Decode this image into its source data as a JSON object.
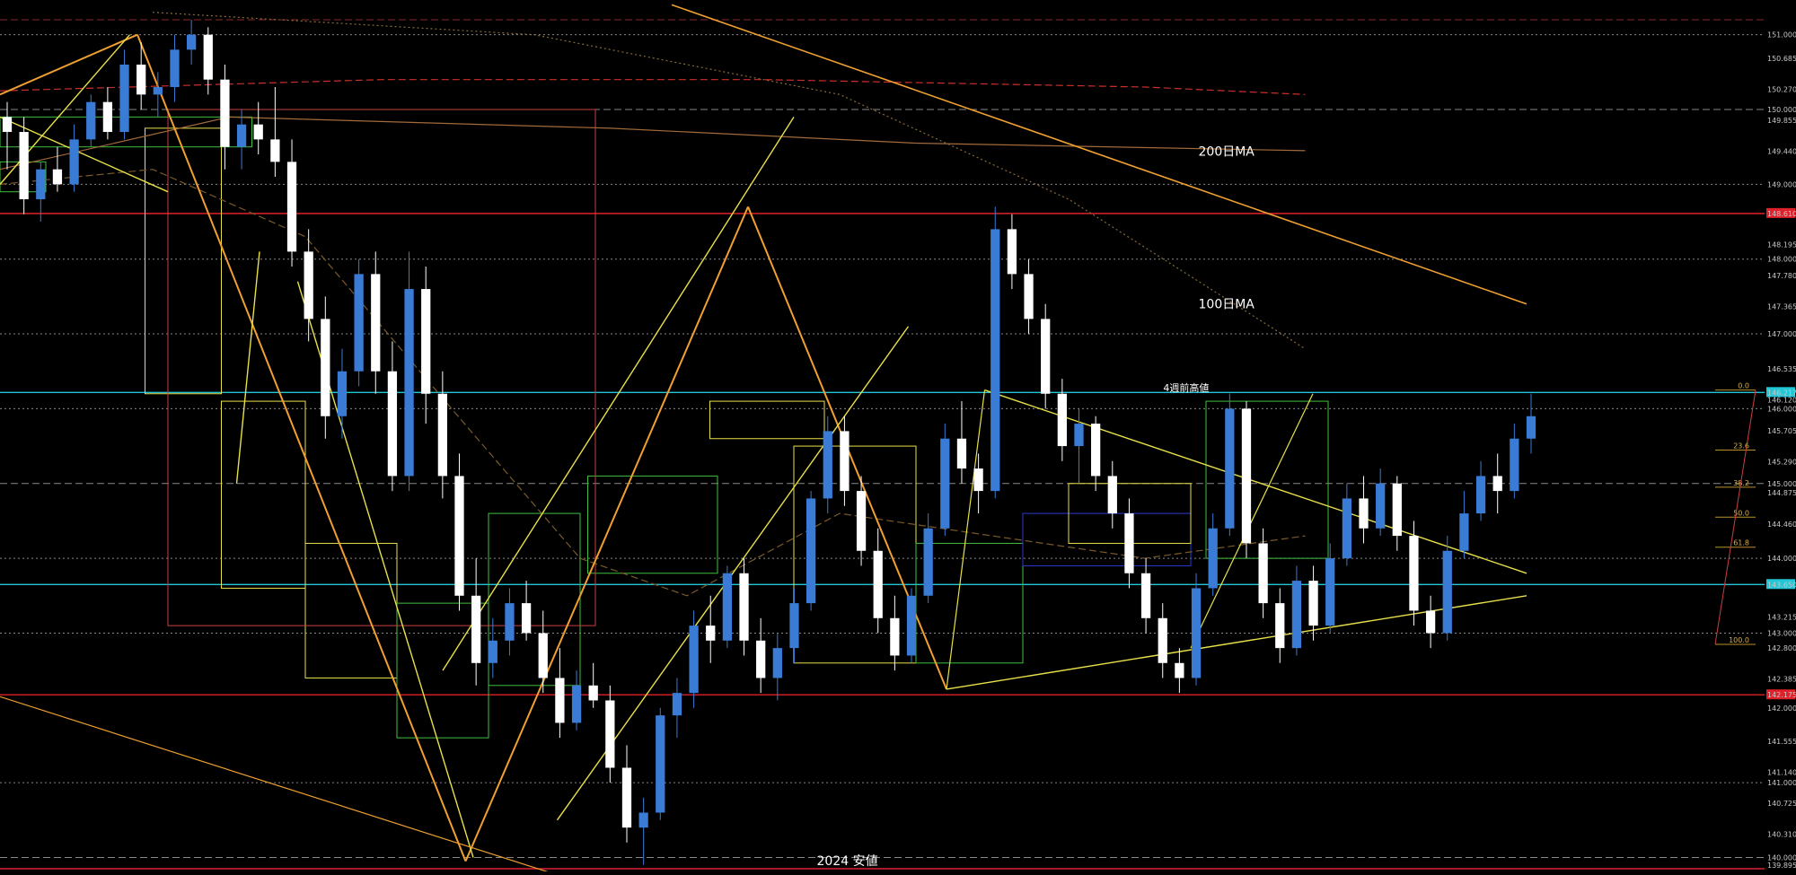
{
  "chart_data": {
    "type": "candlestick",
    "background": "#000000",
    "y_axis": {
      "min": 139.85,
      "max": 151.2,
      "tick_labels": [
        "151.000",
        "150.685",
        "150.270",
        "150.000",
        "149.855",
        "149.440",
        "149.000",
        "148.610",
        "148.195",
        "148.000",
        "147.780",
        "147.365",
        "147.000",
        "146.535",
        "146.217",
        "146.120",
        "146.000",
        "145.705",
        "145.290",
        "145.000",
        "144.875",
        "144.460",
        "144.000",
        "143.650",
        "143.215",
        "143.000",
        "142.800",
        "142.385",
        "142.175",
        "142.000",
        "141.555",
        "141.140",
        "141.000",
        "140.725",
        "140.310",
        "140.000",
        "139.895"
      ],
      "highlighted_labels": [
        {
          "label": "148.610",
          "color": "#e0202a"
        },
        {
          "label": "146.217",
          "color": "#21c7d6"
        },
        {
          "label": "143.650",
          "color": "#21c7d6"
        },
        {
          "label": "142.175",
          "color": "#e0202a"
        }
      ]
    },
    "candles_ohlc": [
      [
        149.9,
        150.1,
        149.2,
        149.7
      ],
      [
        149.7,
        149.9,
        148.6,
        148.8
      ],
      [
        148.8,
        149.3,
        148.5,
        149.2
      ],
      [
        149.2,
        149.5,
        148.9,
        149.0
      ],
      [
        149.0,
        149.8,
        148.9,
        149.6
      ],
      [
        149.6,
        150.2,
        149.5,
        150.1
      ],
      [
        150.1,
        150.3,
        149.6,
        149.7
      ],
      [
        149.7,
        150.8,
        149.6,
        150.6
      ],
      [
        150.6,
        150.9,
        150.0,
        150.2
      ],
      [
        150.2,
        150.5,
        149.9,
        150.3
      ],
      [
        150.3,
        151.0,
        150.1,
        150.8
      ],
      [
        150.8,
        151.2,
        150.6,
        151.0
      ],
      [
        151.0,
        151.1,
        150.2,
        150.4
      ],
      [
        150.4,
        150.6,
        149.2,
        149.5
      ],
      [
        149.5,
        150.0,
        149.2,
        149.8
      ],
      [
        149.8,
        150.1,
        149.4,
        149.6
      ],
      [
        149.6,
        150.3,
        149.1,
        149.3
      ],
      [
        149.3,
        149.6,
        147.9,
        148.1
      ],
      [
        148.1,
        148.4,
        146.9,
        147.2
      ],
      [
        147.2,
        147.5,
        145.6,
        145.9
      ],
      [
        145.9,
        146.8,
        145.6,
        146.5
      ],
      [
        146.5,
        148.0,
        146.3,
        147.8
      ],
      [
        147.8,
        148.1,
        146.2,
        146.5
      ],
      [
        146.5,
        146.9,
        144.9,
        145.1
      ],
      [
        145.1,
        148.1,
        144.9,
        147.6
      ],
      [
        147.6,
        147.9,
        145.8,
        146.2
      ],
      [
        146.2,
        146.5,
        144.8,
        145.1
      ],
      [
        145.1,
        145.4,
        143.3,
        143.5
      ],
      [
        143.5,
        144.0,
        142.3,
        142.6
      ],
      [
        142.6,
        143.2,
        142.4,
        142.9
      ],
      [
        142.9,
        143.6,
        142.7,
        143.4
      ],
      [
        143.4,
        143.7,
        142.9,
        143.0
      ],
      [
        143.0,
        143.3,
        142.2,
        142.4
      ],
      [
        142.4,
        142.8,
        141.6,
        141.8
      ],
      [
        141.8,
        142.5,
        141.7,
        142.3
      ],
      [
        142.3,
        142.6,
        142.0,
        142.1
      ],
      [
        142.1,
        142.3,
        141.0,
        141.2
      ],
      [
        141.2,
        141.5,
        140.2,
        140.4
      ],
      [
        140.4,
        140.8,
        139.9,
        140.6
      ],
      [
        140.6,
        142.0,
        140.5,
        141.9
      ],
      [
        141.9,
        142.4,
        141.6,
        142.2
      ],
      [
        142.2,
        143.3,
        142.0,
        143.1
      ],
      [
        143.1,
        143.5,
        142.6,
        142.9
      ],
      [
        142.9,
        143.9,
        142.8,
        143.8
      ],
      [
        143.8,
        144.0,
        142.7,
        142.9
      ],
      [
        142.9,
        143.2,
        142.2,
        142.4
      ],
      [
        142.4,
        143.0,
        142.1,
        142.8
      ],
      [
        142.8,
        143.6,
        142.6,
        143.4
      ],
      [
        143.4,
        144.9,
        143.3,
        144.8
      ],
      [
        144.8,
        145.9,
        144.6,
        145.7
      ],
      [
        145.7,
        145.9,
        144.7,
        144.9
      ],
      [
        144.9,
        145.1,
        143.9,
        144.1
      ],
      [
        144.1,
        144.4,
        143.0,
        143.2
      ],
      [
        143.2,
        143.5,
        142.5,
        142.7
      ],
      [
        142.7,
        143.6,
        142.6,
        143.5
      ],
      [
        143.5,
        144.6,
        143.4,
        144.4
      ],
      [
        144.4,
        145.8,
        144.3,
        145.6
      ],
      [
        145.6,
        146.1,
        145.0,
        145.2
      ],
      [
        145.2,
        145.4,
        144.6,
        144.9
      ],
      [
        144.9,
        148.7,
        144.8,
        148.4
      ],
      [
        148.4,
        148.6,
        147.6,
        147.8
      ],
      [
        147.8,
        148.0,
        147.0,
        147.2
      ],
      [
        147.2,
        147.4,
        146.0,
        146.2
      ],
      [
        146.2,
        146.4,
        145.3,
        145.5
      ],
      [
        145.5,
        146.0,
        145.0,
        145.8
      ],
      [
        145.8,
        145.9,
        144.9,
        145.1
      ],
      [
        145.1,
        145.3,
        144.4,
        144.6
      ],
      [
        144.6,
        144.8,
        143.6,
        143.8
      ],
      [
        143.8,
        144.0,
        143.0,
        143.2
      ],
      [
        143.2,
        143.4,
        142.4,
        142.6
      ],
      [
        142.6,
        142.8,
        142.2,
        142.4
      ],
      [
        142.4,
        143.8,
        142.3,
        143.6
      ],
      [
        143.6,
        144.6,
        143.5,
        144.4
      ],
      [
        144.4,
        146.2,
        144.3,
        146.0
      ],
      [
        146.0,
        146.1,
        144.0,
        144.2
      ],
      [
        144.2,
        144.4,
        143.2,
        143.4
      ],
      [
        143.4,
        143.6,
        142.6,
        142.8
      ],
      [
        142.8,
        143.9,
        142.7,
        143.7
      ],
      [
        143.7,
        143.9,
        142.9,
        143.1
      ],
      [
        143.1,
        144.2,
        143.0,
        144.0
      ],
      [
        144.0,
        145.0,
        143.9,
        144.8
      ],
      [
        144.8,
        145.1,
        144.2,
        144.4
      ],
      [
        144.4,
        145.2,
        144.3,
        145.0
      ],
      [
        145.0,
        145.1,
        144.1,
        144.3
      ],
      [
        144.3,
        144.5,
        143.1,
        143.3
      ],
      [
        143.3,
        143.5,
        142.8,
        143.0
      ],
      [
        143.0,
        144.3,
        142.9,
        144.1
      ],
      [
        144.1,
        144.9,
        144.0,
        144.6
      ],
      [
        144.6,
        145.3,
        144.5,
        145.1
      ],
      [
        145.1,
        145.4,
        144.6,
        144.9
      ],
      [
        144.9,
        145.8,
        144.8,
        145.6
      ],
      [
        145.6,
        146.2,
        145.4,
        145.9
      ]
    ],
    "moving_averages": [
      {
        "name": "200日MA",
        "color": "#c9302c",
        "style": "dashed",
        "points": [
          [
            0,
            150.25
          ],
          [
            0.25,
            150.4
          ],
          [
            0.5,
            150.4
          ],
          [
            0.75,
            150.3
          ],
          [
            0.855,
            150.2
          ]
        ]
      },
      {
        "name": "",
        "color": "#a26a3a",
        "style": "solid",
        "points": [
          [
            0,
            149.2
          ],
          [
            0.15,
            149.9
          ],
          [
            0.4,
            149.75
          ],
          [
            0.6,
            149.55
          ],
          [
            0.855,
            149.45
          ]
        ]
      },
      {
        "name": "100日MA",
        "color": "#8a6a3a",
        "style": "dotted",
        "points": [
          [
            0.1,
            151.3
          ],
          [
            0.35,
            151.0
          ],
          [
            0.55,
            150.2
          ],
          [
            0.7,
            148.8
          ],
          [
            0.855,
            146.8
          ]
        ]
      },
      {
        "name": "",
        "color": "#7a5a2a",
        "style": "dashed",
        "points": [
          [
            0.0,
            149.0
          ],
          [
            0.1,
            149.2
          ],
          [
            0.2,
            148.3
          ],
          [
            0.3,
            145.9
          ],
          [
            0.38,
            144.0
          ],
          [
            0.45,
            143.5
          ],
          [
            0.55,
            144.6
          ],
          [
            0.65,
            144.3
          ],
          [
            0.75,
            144.0
          ],
          [
            0.855,
            144.3
          ]
        ]
      }
    ],
    "horizontal_levels": [
      {
        "price": 151.2,
        "color": "#8a2a2a",
        "style": "dashed"
      },
      {
        "price": 151.0,
        "color": "#888888",
        "style": "dotted"
      },
      {
        "price": 150.0,
        "color": "#888888",
        "style": "dashed"
      },
      {
        "price": 149.0,
        "color": "#888888",
        "style": "dotted"
      },
      {
        "price": 148.61,
        "color": "#e0202a",
        "style": "solid"
      },
      {
        "price": 148.0,
        "color": "#888888",
        "style": "dotted"
      },
      {
        "price": 147.0,
        "color": "#888888",
        "style": "dotted"
      },
      {
        "price": 146.217,
        "color": "#21c7d6",
        "style": "solid"
      },
      {
        "price": 146.0,
        "color": "#888888",
        "style": "dotted"
      },
      {
        "price": 145.0,
        "color": "#888888",
        "style": "dashed"
      },
      {
        "price": 144.0,
        "color": "#888888",
        "style": "dotted"
      },
      {
        "price": 143.65,
        "color": "#21c7d6",
        "style": "solid"
      },
      {
        "price": 143.0,
        "color": "#888888",
        "style": "dotted"
      },
      {
        "price": 142.175,
        "color": "#e0202a",
        "style": "solid"
      },
      {
        "price": 141.0,
        "color": "#888888",
        "style": "dotted"
      },
      {
        "price": 140.0,
        "color": "#888888",
        "style": "dashed"
      },
      {
        "price": 139.85,
        "color": "#e0202a",
        "style": "solid"
      }
    ],
    "fibonacci_labels": [
      "0.0",
      "23.6",
      "38.2",
      "50.0",
      "61.8",
      "100.0"
    ],
    "annotations": [
      {
        "text": "200日MA",
        "price": 149.44,
        "x_frac": 0.785,
        "class": "annot"
      },
      {
        "text": "100日MA",
        "price": 147.4,
        "x_frac": 0.785,
        "class": "annot"
      },
      {
        "text": "4週前高値",
        "price": 146.29,
        "x_frac": 0.762,
        "class": "annot-small"
      },
      {
        "text": "2024 安値",
        "price": 139.96,
        "x_frac": 0.535,
        "class": "annot"
      }
    ],
    "colors": {
      "bull": "#3a7bd5",
      "bear": "#ffffff",
      "trend_yellow": "#e8e04a",
      "trend_orange": "#f0a030",
      "box_green": "#3fbf3f",
      "box_red": "#c84040",
      "box_blue": "#2a3ad0"
    }
  }
}
